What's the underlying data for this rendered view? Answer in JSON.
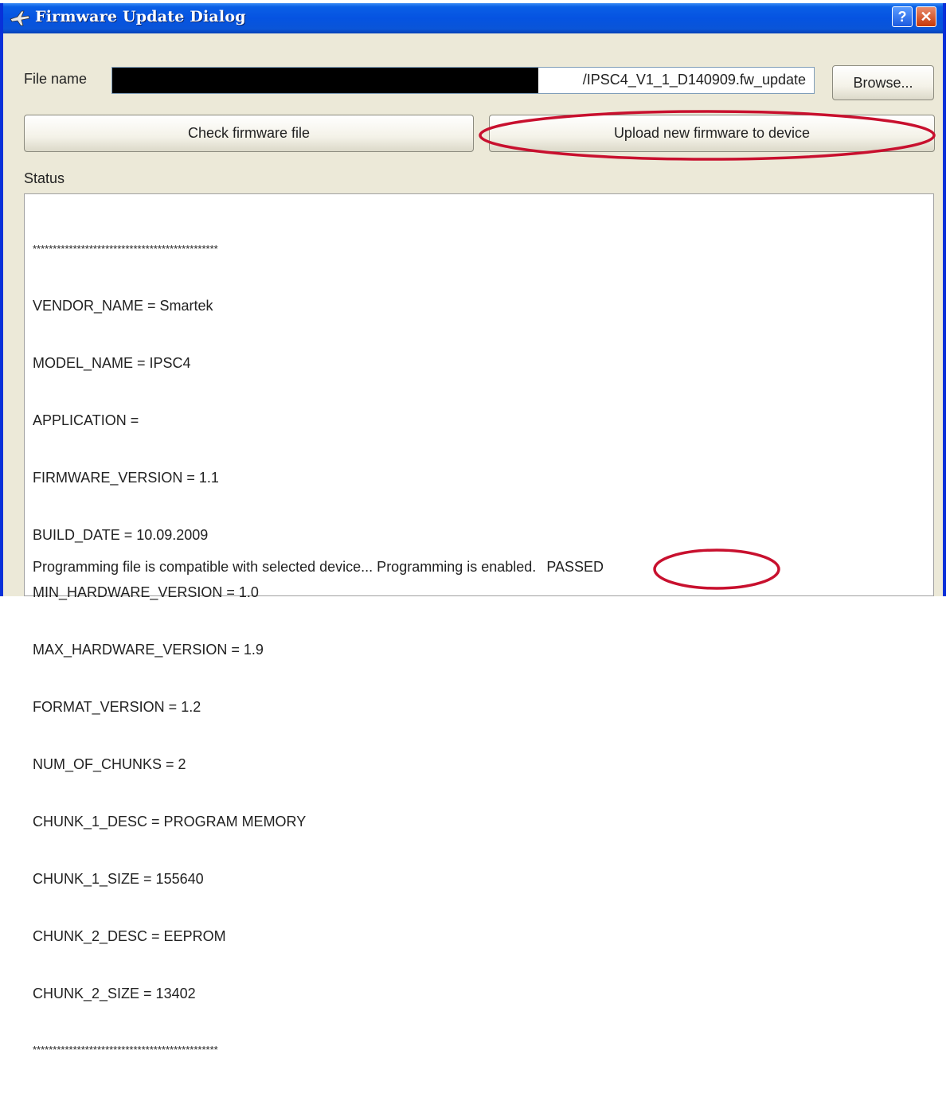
{
  "window": {
    "title": "Firmware Update Dialog",
    "help_glyph": "?",
    "close_glyph": "✕"
  },
  "file": {
    "label": "File name",
    "value": "/IPSC4_V1_1_D140909.fw_update"
  },
  "buttons": {
    "browse": "Browse...",
    "check": "Check firmware file",
    "upload": "Upload new firmware to device"
  },
  "status": {
    "label": "Status",
    "separator": "**********************************************",
    "lines": [
      "VENDOR_NAME = Smartek",
      "MODEL_NAME = IPSC4",
      "APPLICATION =",
      "FIRMWARE_VERSION = 1.1",
      "BUILD_DATE = 10.09.2009",
      "MIN_HARDWARE_VERSION = 1.0",
      "MAX_HARDWARE_VERSION = 1.9",
      "FORMAT_VERSION = 1.2",
      "NUM_OF_CHUNKS = 2",
      "CHUNK_1_DESC = PROGRAM MEMORY",
      "CHUNK_1_SIZE = 155640",
      "CHUNK_2_DESC = EEPROM",
      "CHUNK_2_SIZE = 13402"
    ],
    "result_message": "Programming file is compatible with selected device... Programming is enabled.",
    "result_status": "PASSED"
  },
  "colors": {
    "titlebar": "#0553e1",
    "annotation": "#c8102e",
    "dialog_bg": "#ece9d8"
  },
  "icons": {
    "app": "airplane-icon",
    "help": "help-icon",
    "close": "close-icon"
  }
}
